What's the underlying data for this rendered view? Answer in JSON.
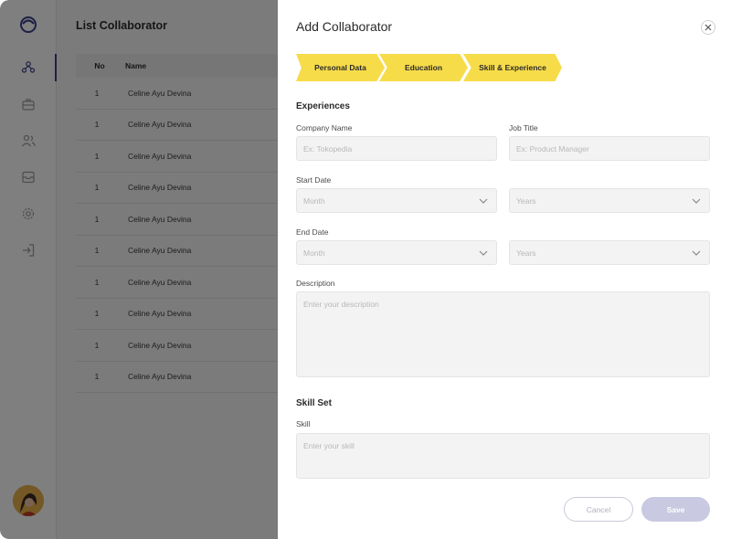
{
  "page": {
    "title": "List Collaborator"
  },
  "sidebar": {
    "items": [
      {
        "icon": "people-network-icon",
        "active": true
      },
      {
        "icon": "briefcase-icon",
        "active": false
      },
      {
        "icon": "users-icon",
        "active": false
      },
      {
        "icon": "inbox-icon",
        "active": false
      },
      {
        "icon": "settings-icon",
        "active": false
      },
      {
        "icon": "logout-icon",
        "active": false
      }
    ]
  },
  "table": {
    "columns": [
      "No",
      "Name"
    ],
    "rows": [
      {
        "no": "1",
        "name": "Celine Ayu Devina"
      },
      {
        "no": "1",
        "name": "Celine Ayu Devina"
      },
      {
        "no": "1",
        "name": "Celine Ayu Devina"
      },
      {
        "no": "1",
        "name": "Celine Ayu Devina"
      },
      {
        "no": "1",
        "name": "Celine Ayu Devina"
      },
      {
        "no": "1",
        "name": "Celine Ayu Devina"
      },
      {
        "no": "1",
        "name": "Celine Ayu Devina"
      },
      {
        "no": "1",
        "name": "Celine Ayu Devina"
      },
      {
        "no": "1",
        "name": "Celine Ayu Devina"
      },
      {
        "no": "1",
        "name": "Celine Ayu Devina"
      }
    ]
  },
  "drawer": {
    "title": "Add Collaborator",
    "steps": [
      "Personal Data",
      "Education",
      "Skill & Experience"
    ],
    "experiences": {
      "section_title": "Experiences",
      "company_label": "Company Name",
      "company_placeholder": "Ex: Tokopedia",
      "job_label": "Job Title",
      "job_placeholder": "Ex: Product Manager",
      "start_label": "Start Date",
      "start_month": "Month",
      "start_year": "Years",
      "end_label": "End Date",
      "end_month": "Month",
      "end_year": "Years",
      "description_label": "Description",
      "description_placeholder": "Enter your description"
    },
    "skills": {
      "section_title": "Skill Set",
      "skill_label": "Skill",
      "skill_placeholder": "Enter your skill"
    },
    "buttons": {
      "cancel": "Cancel",
      "save": "Save"
    }
  },
  "colors": {
    "step": "#f7dc4a",
    "accent": "#3c3f8f",
    "save_disabled": "#c9c9e1"
  }
}
